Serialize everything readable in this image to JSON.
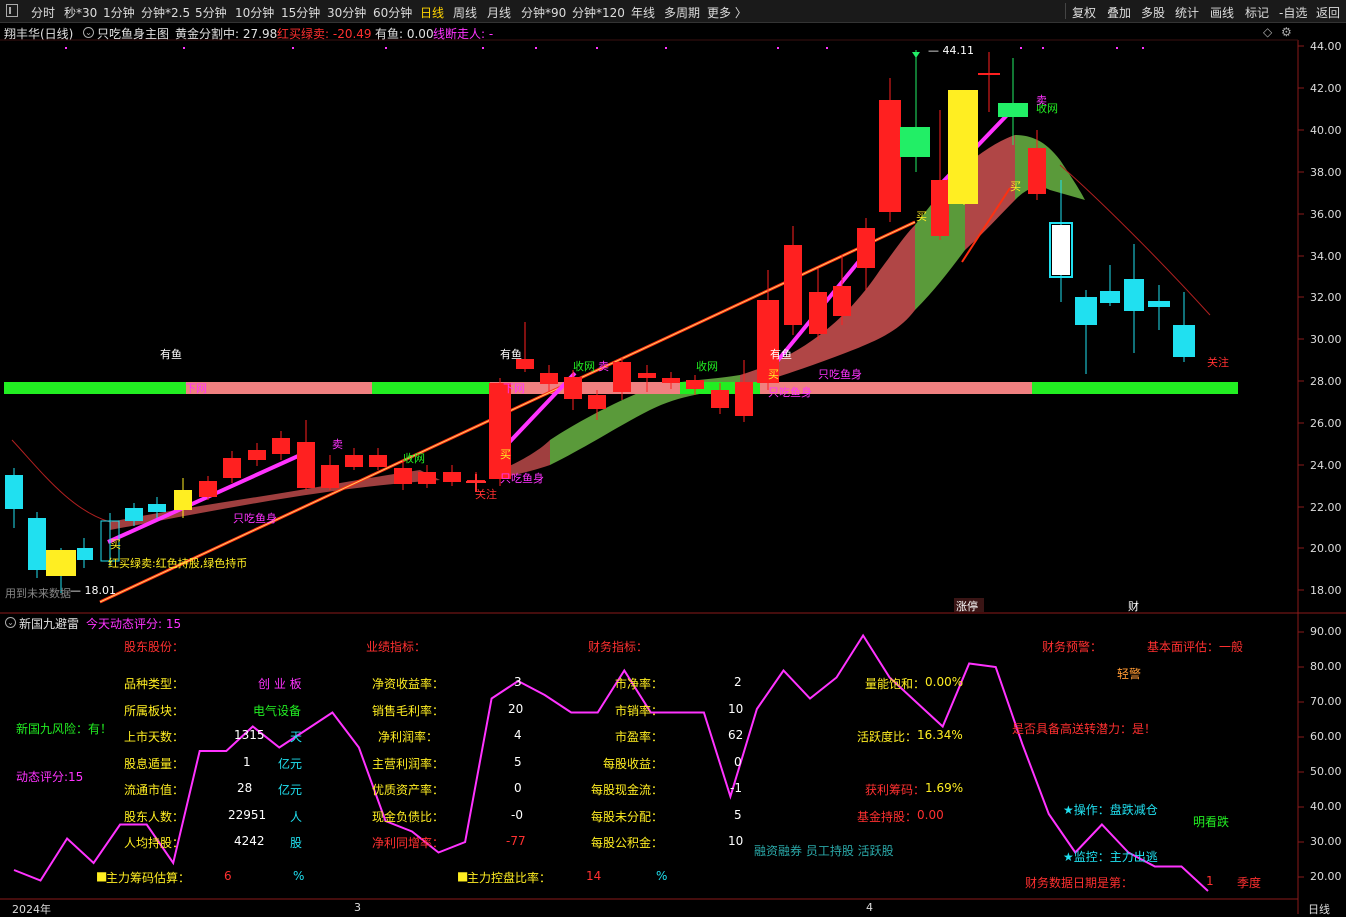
{
  "toolbar": {
    "periods": [
      "分时",
      "秒*30",
      "1分钟",
      "分钟*2.5",
      "5分钟",
      "10分钟",
      "15分钟",
      "30分钟",
      "60分钟",
      "日线",
      "周线",
      "月线",
      "分钟*90",
      "分钟*120",
      "年线",
      "多周期",
      "更多 〉"
    ],
    "active_period": "日线",
    "right_tools": [
      "复权",
      "叠加",
      "多股",
      "统计",
      "画线",
      "标记",
      "-自选",
      "返回"
    ]
  },
  "header": {
    "stock": "翔丰华(日线)",
    "indicator": "只吃鱼身主图",
    "golden": "黄金分割中: 27.98",
    "redbuy": "红买绿卖: -20.49",
    "youyu": "有鱼: 0.00",
    "line_break": "线断走人: -"
  },
  "colors": {
    "up": "#ff2020",
    "down": "#20e0f0",
    "fish_red": "#c04848",
    "fish_green": "#5a9a3a",
    "magenta": "#ff33ff",
    "pink_bar": "#f08080",
    "green_bar": "#22ee22"
  },
  "price_axis": [
    "44.00",
    "42.00",
    "40.00",
    "38.00",
    "36.00",
    "34.00",
    "32.00",
    "30.00",
    "28.00",
    "26.00",
    "24.00",
    "22.00",
    "20.00",
    "18.00"
  ],
  "price_labels": {
    "high": "44.11",
    "low": "18.01",
    "shouwang": "收网",
    "youyu": "有鱼",
    "xiawang": "下网",
    "fish_body": "只吃鱼身",
    "sell": "卖",
    "buy": "买",
    "attention": "关注",
    "legend_text": "红买绿卖:红色持股,绿色持币",
    "future_text": "用到未来数据",
    "zhangting": "涨停",
    "cai": "财"
  },
  "lower_panel": {
    "title": "新国九避雷",
    "score_title": "今天动态评分: 15",
    "axis": [
      "90.00",
      "80.00",
      "70.00",
      "60.00",
      "50.00",
      "40.00",
      "30.00",
      "20.00"
    ],
    "section_shareholder": "股东股份：",
    "section_perf": "业绩指标：",
    "section_fin": "财务指标：",
    "section_warn": "财务预警：",
    "fund_eval": "基本面评估：一般",
    "light_warn": "轻警",
    "risk": "新国九风险：有！",
    "dyn_score": "动态评分:15",
    "col1": [
      {
        "k": "品种类型：",
        "v": "创 业 板",
        "u": ""
      },
      {
        "k": "所属板块：",
        "v": "电气设备",
        "u": ""
      },
      {
        "k": "上市天数：",
        "v": "1315",
        "u": "天"
      },
      {
        "k": "股息遁量：",
        "v": "1",
        "u": "亿元"
      },
      {
        "k": "流通市值：",
        "v": "28",
        "u": "亿元"
      },
      {
        "k": "股东人数：",
        "v": "22951",
        "u": "人"
      },
      {
        "k": "人均持股：",
        "v": "4242",
        "u": "股"
      }
    ],
    "col2": [
      {
        "k": "净资收益率：",
        "v": "3"
      },
      {
        "k": "销售毛利率：",
        "v": "20"
      },
      {
        "k": "净利润率：",
        "v": "4"
      },
      {
        "k": "主营利润率：",
        "v": "5"
      },
      {
        "k": "优质资产率：",
        "v": "0"
      },
      {
        "k": "现金负债比：",
        "v": "-0"
      },
      {
        "k": "净利同增率：",
        "v": "-77"
      }
    ],
    "col3": [
      {
        "k": "市净率：",
        "v": "2"
      },
      {
        "k": "市销率：",
        "v": "10"
      },
      {
        "k": "市盈率：",
        "v": "62"
      },
      {
        "k": "每股收益：",
        "v": "0"
      },
      {
        "k": "每股现金流：",
        "v": "-1"
      },
      {
        "k": "每股未分配：",
        "v": "5"
      },
      {
        "k": "每股公积金：",
        "v": "10"
      }
    ],
    "col4": [
      {
        "k": "量能饱和：",
        "v": "0.00%"
      },
      {
        "k": "活跃度比：",
        "v": "16.34%"
      },
      {
        "k": "获利筹码：",
        "v": "1.69%"
      },
      {
        "k": "基金持股：",
        "v": "0.00"
      }
    ],
    "song": "是否具备高送转潜力：是！",
    "op": "★操作：盘跌减仓",
    "watch": "明看跌",
    "monitor": "★监控：主力出逃",
    "tags": "融资融券 员工持股 活跃股",
    "report_date": "财务数据日期是第：",
    "report_q": "1",
    "report_unit": "季度",
    "chip_est": "主力筹码估算：",
    "chip_est_v": "6",
    "chip_ctrl": "主力控盘比率：",
    "chip_ctrl_v": "14",
    "pct": "%"
  },
  "x_axis": [
    "2024年",
    "3",
    "4",
    "日线"
  ],
  "score_series": [
    22,
    19,
    31,
    24,
    35,
    35,
    24,
    56,
    56,
    63,
    57,
    62,
    67,
    57,
    36,
    33,
    27,
    30,
    71,
    76,
    72,
    67,
    67,
    79,
    67,
    67,
    67,
    43,
    68,
    79,
    71,
    77,
    89,
    77,
    70,
    63,
    81,
    80,
    58,
    38,
    27,
    35,
    27,
    23,
    23,
    16
  ]
}
